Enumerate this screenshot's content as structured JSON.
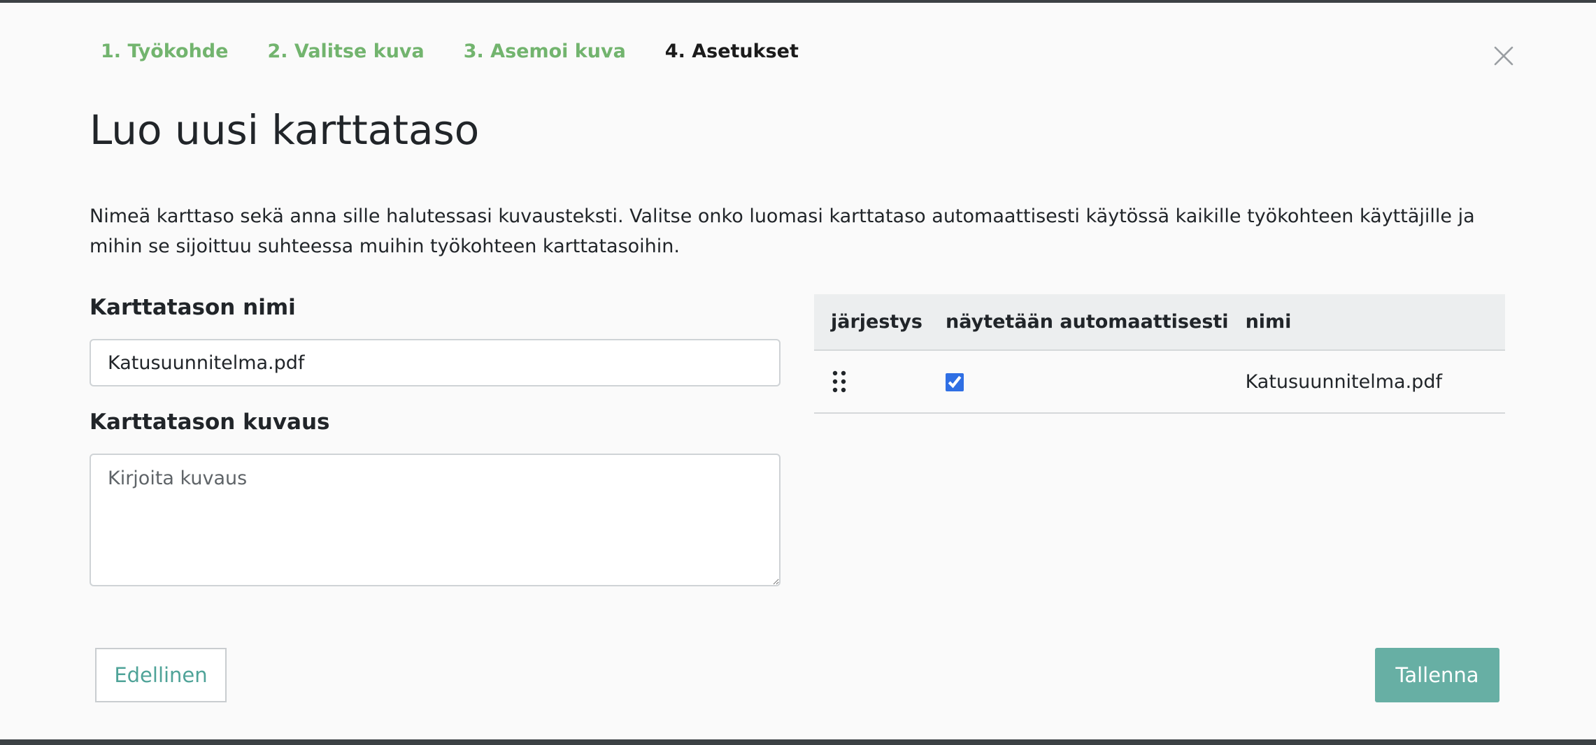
{
  "wizard": {
    "steps": [
      {
        "label": "1. Työkohde",
        "state": "done"
      },
      {
        "label": "2. Valitse kuva",
        "state": "done"
      },
      {
        "label": "3. Asemoi kuva",
        "state": "done"
      },
      {
        "label": "4. Asetukset",
        "state": "active"
      }
    ],
    "close_icon": "close-icon"
  },
  "page": {
    "title": "Luo uusi karttataso",
    "intro": "Nimeä karttaso sekä anna sille halutessasi kuvausteksti. Valitse onko luomasi karttataso automaattisesti käytössä kaikille työkohteen käyttäjille ja mihin se sijoittuu suhteessa muihin työkohteen karttatasoihin."
  },
  "form": {
    "name_label": "Karttatason nimi",
    "name_value": "Katusuunnitelma.pdf",
    "description_label": "Karttatason kuvaus",
    "description_placeholder": "Kirjoita kuvaus",
    "description_value": ""
  },
  "layer_table": {
    "headers": {
      "order": "järjestys",
      "auto_show": "näytetään automaattisesti",
      "name": "nimi"
    },
    "rows": [
      {
        "drag_icon": "drag-handle-icon",
        "auto_show": true,
        "name": "Katusuunnitelma.pdf"
      }
    ]
  },
  "footer": {
    "prev_label": "Edellinen",
    "save_label": "Tallenna"
  },
  "colors": {
    "step_done": "#72b46e",
    "step_active": "#1b1b1b",
    "primary_button": "#67afa4",
    "secondary_button_text": "#4fa398",
    "checkbox": "#2f6fe4"
  }
}
